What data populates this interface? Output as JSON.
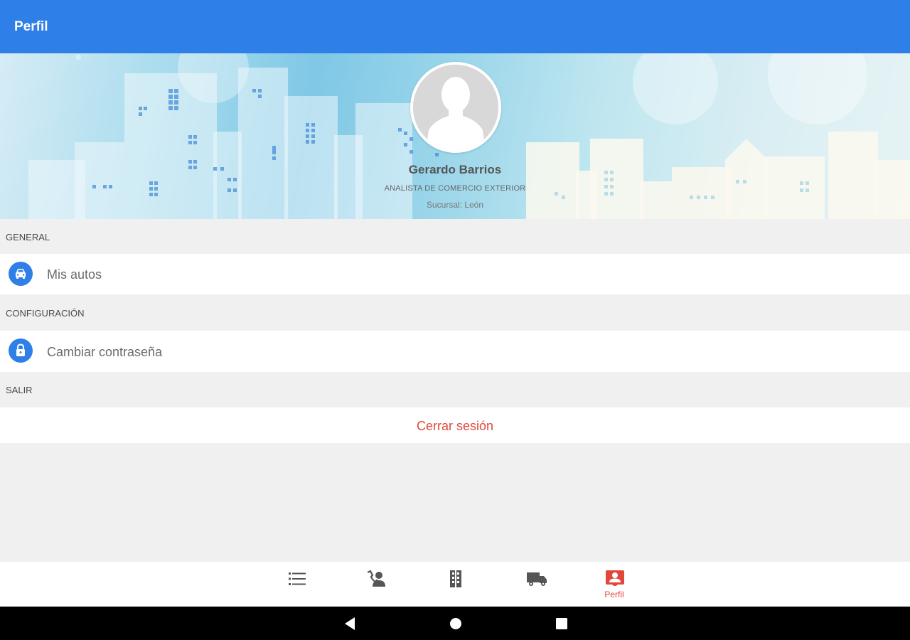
{
  "appbar": {
    "title": "Perfil",
    "color": "#2f7fe8"
  },
  "profile": {
    "name": "Gerardo Barrios",
    "role": "ANALISTA DE COMERCIO EXTERIOR",
    "branch": "Sucursal: León",
    "avatar_icon": "person-placeholder-icon",
    "banner": "city-skyline-watercolor"
  },
  "sections": [
    {
      "header": "GENERAL",
      "items": [
        {
          "label": "Mis autos",
          "icon": "car-icon"
        }
      ]
    },
    {
      "header": "CONFIGURACIÓN",
      "items": [
        {
          "label": "Cambiar contraseña",
          "icon": "lock-icon"
        }
      ]
    },
    {
      "header": "SALIR",
      "items": [
        {
          "label": "Cerrar sesión",
          "color": "#e0483c"
        }
      ]
    }
  ],
  "bottom_nav": {
    "items": [
      {
        "icon": "list-icon",
        "label": ""
      },
      {
        "icon": "contact-phone-icon",
        "label": ""
      },
      {
        "icon": "building-icon",
        "label": ""
      },
      {
        "icon": "truck-icon",
        "label": ""
      },
      {
        "icon": "profile-icon",
        "label": "Perfil",
        "active": true
      }
    ],
    "active_color": "#e0483c",
    "inactive_color": "#555555"
  },
  "system_nav": {
    "items": [
      "back-icon",
      "home-icon",
      "recents-icon"
    ]
  }
}
